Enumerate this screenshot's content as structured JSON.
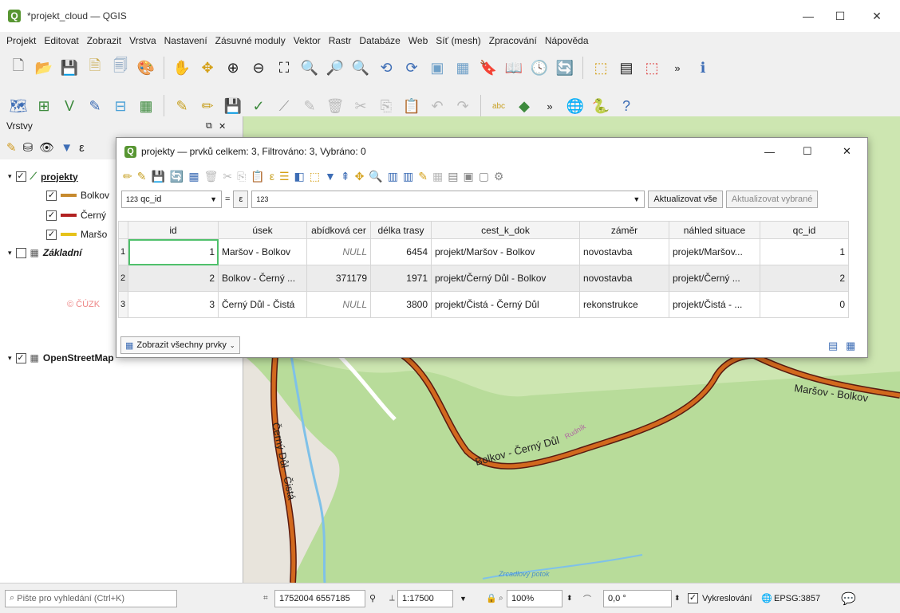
{
  "window": {
    "title": "*projekt_cloud — QGIS",
    "app_icon": "Q",
    "minimize": "—",
    "maximize": "☐",
    "close": "✕"
  },
  "menu": [
    "Projekt",
    "Editovat",
    "Zobrazit",
    "Vrstva",
    "Nastavení",
    "Zásuvné moduly",
    "Vektor",
    "Rastr",
    "Databáze",
    "Web",
    "Síť (mesh)",
    "Zpracování",
    "Nápověda"
  ],
  "layers_panel": {
    "title": "Vrstvy",
    "layers": [
      {
        "name": "projekty",
        "checked": "✓"
      },
      {
        "name": "Bolkov",
        "checked": "✓",
        "color": "#c78a2e"
      },
      {
        "name": "Černý",
        "checked": "✓",
        "color": "#b22222"
      },
      {
        "name": "Maršo",
        "checked": "✓",
        "color": "#e6c21a"
      },
      {
        "name": "Základní",
        "checked": ""
      },
      {
        "name": "OpenStreetMap",
        "checked": "✓"
      }
    ],
    "watermark": "© ČÚZK"
  },
  "dialog": {
    "title": "projekty — prvků celkem: 3, Filtrováno: 3, Vybráno: 0",
    "field_select": "qc_id",
    "field_type_prefix": "123",
    "operator": "=",
    "expression_icon": "ε",
    "value_prefix": "123",
    "update_all": "Aktualizovat vše",
    "update_selected": "Aktualizovat vybrané",
    "show_all": "Zobrazit všechny prvky",
    "columns": [
      "id",
      "úsek",
      "abídková cer",
      "délka trasy",
      "cest_k_dok",
      "záměr",
      "náhled situace",
      "qc_id"
    ],
    "rows": [
      {
        "row": "1",
        "id": "1",
        "usek": "Maršov - Bolkov",
        "cena": "NULL",
        "delka": "6454",
        "cest": "projekt/Maršov - Bolkov",
        "zamer": "novostavba",
        "nahled": "projekt/Maršov...",
        "qc_id": "1"
      },
      {
        "row": "2",
        "id": "2",
        "usek": "Bolkov - Černý ...",
        "cena": "371179",
        "delka": "1971",
        "cest": "projekt/Černý Důl - Bolkov",
        "zamer": "novostavba",
        "nahled": "projekt/Černý ...",
        "qc_id": "2"
      },
      {
        "row": "3",
        "id": "3",
        "usek": "Černý Důl - Čistá",
        "cena": "NULL",
        "delka": "3800",
        "cest": "projekt/Čistá - Černý Důl",
        "zamer": "rekonstrukce",
        "nahled": "projekt/Čistá - ...",
        "qc_id": "0"
      }
    ]
  },
  "map": {
    "labels": {
      "marsov": "Maršov - Bolkov",
      "bolkov": "Bolkov - Černý Důl",
      "cerny": "Černý Důl - Čistá",
      "rudnik": "Rudník",
      "potok": "Zrcadlový potok"
    }
  },
  "statusbar": {
    "search_placeholder": "Pište pro vyhledání (Ctrl+K)",
    "coords": "1752004 6557185",
    "scale": "1:17500",
    "magnifier": "100%",
    "rotation": "0,0 °",
    "render_label": "Vykreslování",
    "render_checked": "✓",
    "crs": "EPSG:3857"
  }
}
